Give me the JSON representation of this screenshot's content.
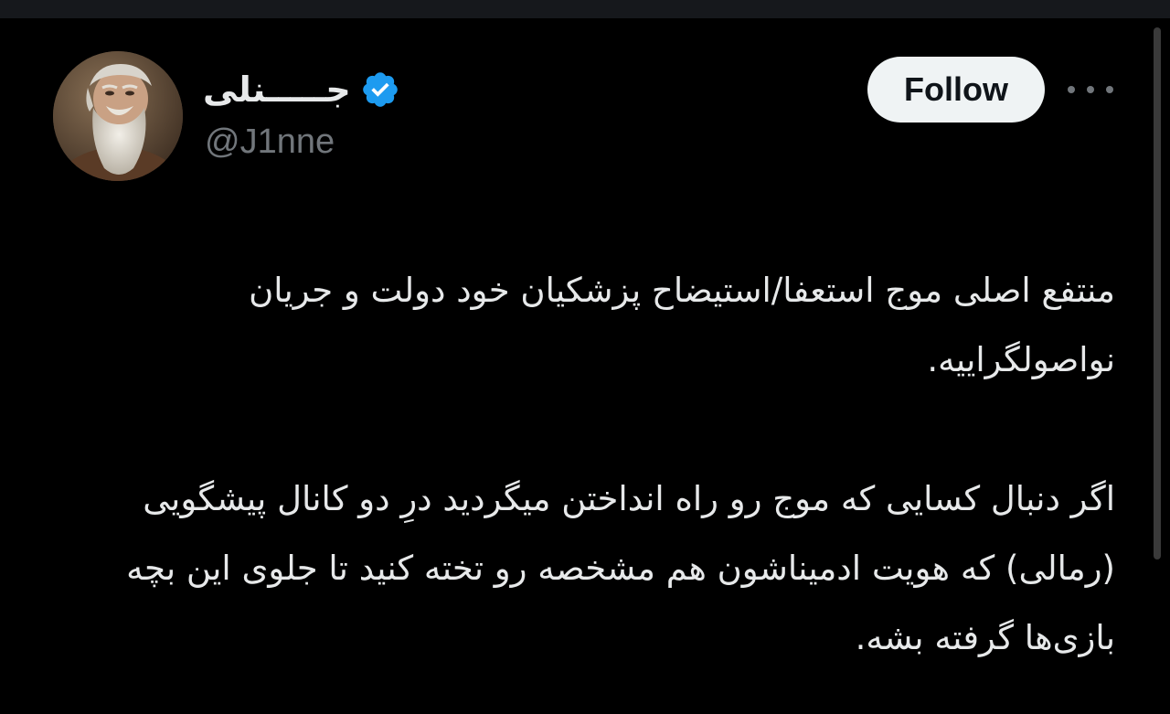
{
  "tweet": {
    "author": {
      "display_name": "جـــــنلی",
      "handle": "@J1nne",
      "verified": true,
      "avatar_icon": "bearded-old-man-portrait"
    },
    "follow_label": "Follow",
    "more_icon": "more-horizontal-icon",
    "paragraphs": [
      "منتفع اصلی موج استعفا/استیضاح پزشکیان خود دولت و جریان نواصولگراییه.",
      "اگر دنبال کسایی که موج رو راه انداختن میگردید درِ دو کانال پیشگویی (رمالی) که هویت ادمیناشون هم مشخصه رو تخته کنید تا جلوی این بچه بازی‌ها گرفته بشه."
    ]
  },
  "colors": {
    "background": "#000000",
    "text": "#e7e9ea",
    "secondary_text": "#71767b",
    "verified_badge": "#1d9bf0",
    "follow_button_bg": "#eff3f4",
    "follow_button_text": "#0f1419"
  }
}
